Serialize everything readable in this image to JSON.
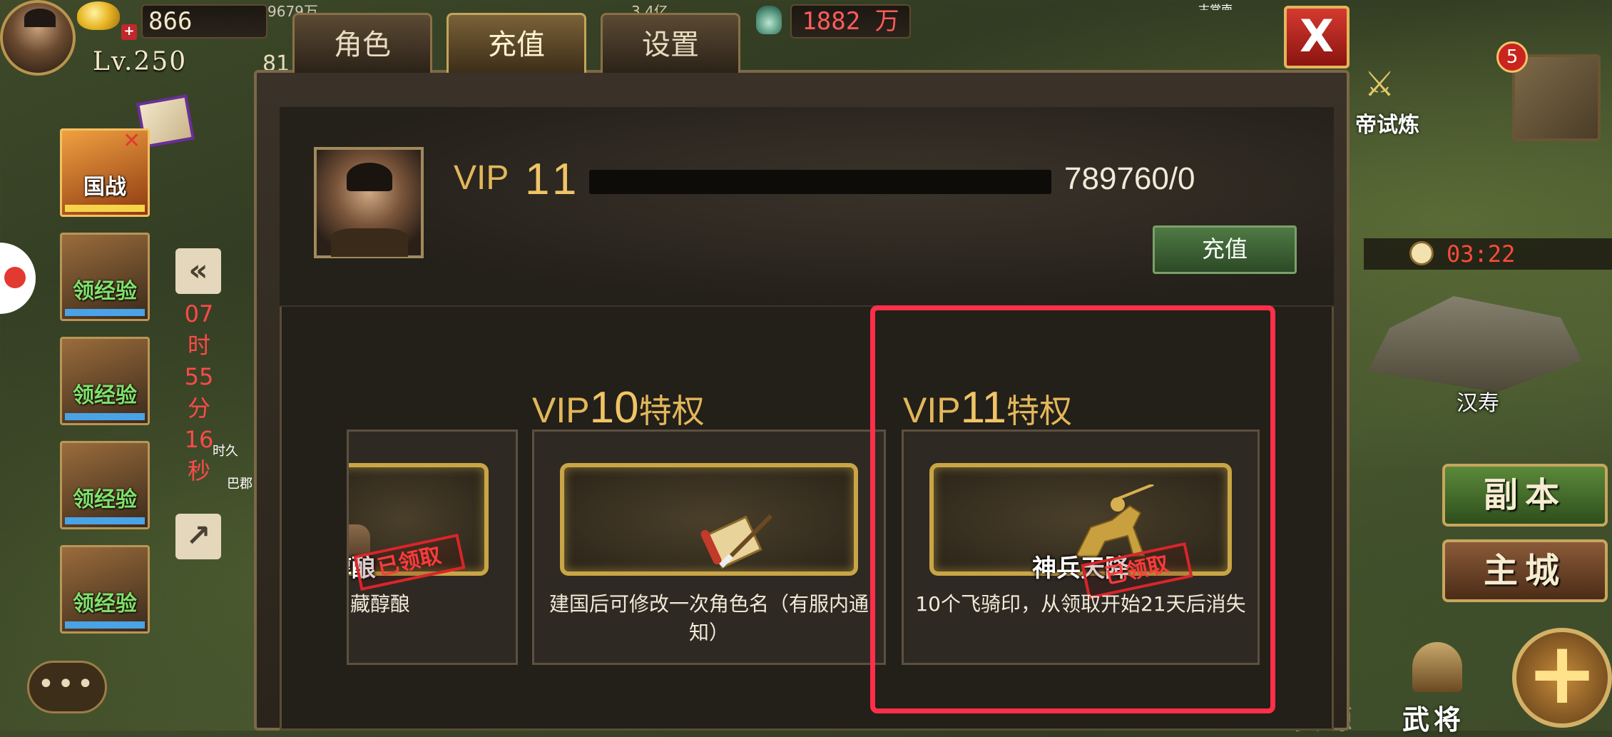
{
  "hud": {
    "gold": "866",
    "silver_partial": "9679万",
    "level": "Lv.250",
    "power_partial": "81",
    "food": "1882 万",
    "hud_partial_2": "3.4亿"
  },
  "tabs": [
    {
      "label": "角色"
    },
    {
      "label": "充值"
    },
    {
      "label": "设置"
    }
  ],
  "close_button": "X",
  "left_panel": {
    "national_war": "国战",
    "xp_cards": [
      "领经验",
      "领经验",
      "领经验",
      "领经验"
    ],
    "collapse_glyph": "«",
    "expand_glyph": "↗",
    "countdown": [
      "07",
      "时",
      "55",
      "分",
      "16",
      "秒"
    ],
    "chat_glyph": "•••",
    "map_labels": [
      "时久",
      "巴郡"
    ]
  },
  "right_panel": {
    "notification_count": "5",
    "trial_label": "帝试炼",
    "timer": "03:22",
    "city_label": "汉寿",
    "dungeon_button": "副本",
    "main_city_button": "主城",
    "resource_label": "资源",
    "general_label": "武将",
    "map_top_label": "古常南"
  },
  "vip": {
    "label": "VIP",
    "level": "11",
    "progress_text": "789760/0",
    "progress_fraction": 1.0,
    "recharge_button": "充值"
  },
  "sections": [
    {
      "vip": "VIP",
      "level": "10",
      "suffix": "特权"
    },
    {
      "vip": "VIP",
      "level": "11",
      "suffix": "特权"
    }
  ],
  "perks": [
    {
      "item_name": "醇酿",
      "claimed": "已领取",
      "description": "藏醇酿"
    },
    {
      "item_name": "",
      "claimed": "",
      "description": "建国后可修改一次角色名（有服内通知）"
    },
    {
      "item_name": "神兵天降",
      "claimed": "已领取",
      "description": "10个飞骑印，从领取开始21天后消失"
    }
  ],
  "colors": {
    "accent_gold": "#e2b75a",
    "highlight": "#ff2f4a",
    "timer_red": "#ff4a3a",
    "claimed_red": "#d9252a"
  }
}
